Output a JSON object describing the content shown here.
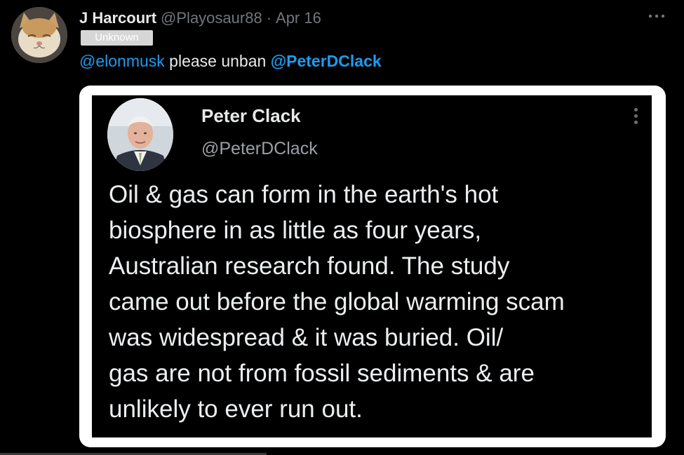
{
  "post": {
    "author": {
      "display_name": "J Harcourt",
      "handle": "@Playosaur88",
      "separator": "·",
      "date": "Apr 16"
    },
    "badge": "Unknown",
    "more_icon": "more-horizontal-icon",
    "text": {
      "mention1": "@elonmusk",
      "middle": " please unban ",
      "mention2": "@PeterDClack"
    }
  },
  "embedded_screenshot": {
    "name": "Peter Clack",
    "handle": "@PeterDClack",
    "more_icon": "more-vertical-icon",
    "body": "Oil & gas can form in the earth's hot\nbiosphere in as little as four years,\nAustralian research found. The study\ncame out before the global warming scam\nwas widespread & it was buried. Oil/\ngas are not from fossil sediments & are\nunlikely to ever run out."
  },
  "colors": {
    "background": "#000000",
    "link": "#1d9bf0",
    "secondary_text": "#71767b",
    "primary_text": "#e7e9ea",
    "media_border": "#ffffff"
  }
}
